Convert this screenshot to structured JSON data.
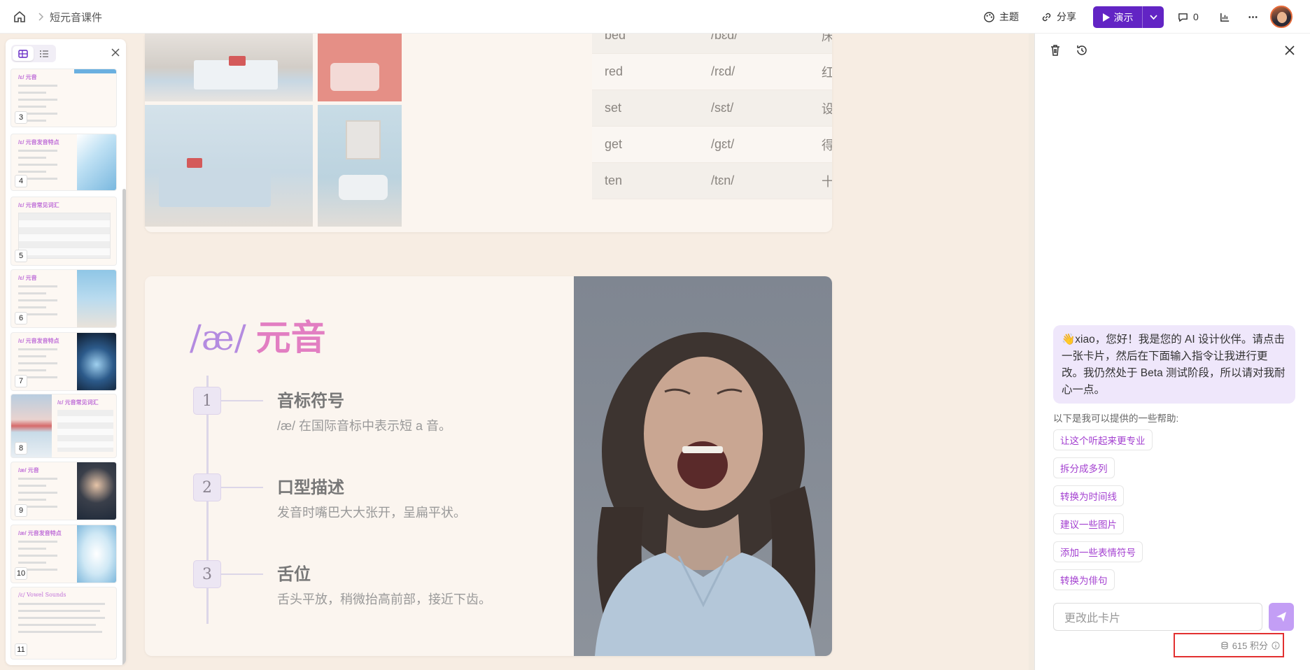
{
  "topbar": {
    "title": "短元音课件",
    "theme_label": "主题",
    "share_label": "分享",
    "present_label": "演示",
    "comments_count": "0"
  },
  "thumbnails": [
    {
      "num": "3",
      "title": "/ɛ/ 元音"
    },
    {
      "num": "4",
      "title": "/ɛ/ 元音发音特点"
    },
    {
      "num": "5",
      "title": "/ɛ/ 元音常见词汇"
    },
    {
      "num": "6",
      "title": "/ɛ/ 元音"
    },
    {
      "num": "7",
      "title": "/ɛ/ 元音发音特点"
    },
    {
      "num": "8",
      "title": "/ɛ/ 元音常见词汇"
    },
    {
      "num": "9",
      "title": "/æ/ 元音"
    },
    {
      "num": "10",
      "title": "/æ/ 元音发音特点"
    },
    {
      "num": "11",
      "title": "/ɛ/ Vowel Sounds"
    }
  ],
  "vocab_table": {
    "rows": [
      {
        "word": "bed",
        "ipa": "/bɛd/",
        "meaning": "床"
      },
      {
        "word": "red",
        "ipa": "/rɛd/",
        "meaning": "红色"
      },
      {
        "word": "set",
        "ipa": "/sɛt/",
        "meaning": "设置"
      },
      {
        "word": "get",
        "ipa": "/gɛt/",
        "meaning": "得到"
      },
      {
        "word": "ten",
        "ipa": "/tɛn/",
        "meaning": "十"
      }
    ]
  },
  "card2": {
    "title_ipa": "/æ/",
    "title_cn": "元音",
    "steps": [
      {
        "num": "1",
        "heading": "音标符号",
        "desc": "/æ/ 在国际音标中表示短 a 音。"
      },
      {
        "num": "2",
        "heading": "口型描述",
        "desc": "发音时嘴巴大大张开，呈扁平状。"
      },
      {
        "num": "3",
        "heading": "舌位",
        "desc": "舌头平放，稍微抬高前部，接近下齿。"
      }
    ]
  },
  "ai_panel": {
    "greeting": "👋xiao，您好！我是您的 AI 设计伙伴。请点击一张卡片，然后在下面输入指令让我进行更改。我仍然处于 Beta 测试阶段，所以请对我耐心一点。",
    "help_label": "以下是我可以提供的一些帮助:",
    "suggestions": [
      "让这个听起来更专业",
      "拆分成多列",
      "转换为时间线",
      "建议一些图片",
      "添加一些表情符号",
      "转换为俳句"
    ],
    "input_placeholder": "更改此卡片",
    "credits": "615 积分"
  },
  "colors": {
    "accent": "#6224c4",
    "title_pink": "#e27ec2",
    "title_purple": "#b48be0",
    "suggestion_text": "#a33fd0",
    "highlight_border": "#e23030"
  }
}
